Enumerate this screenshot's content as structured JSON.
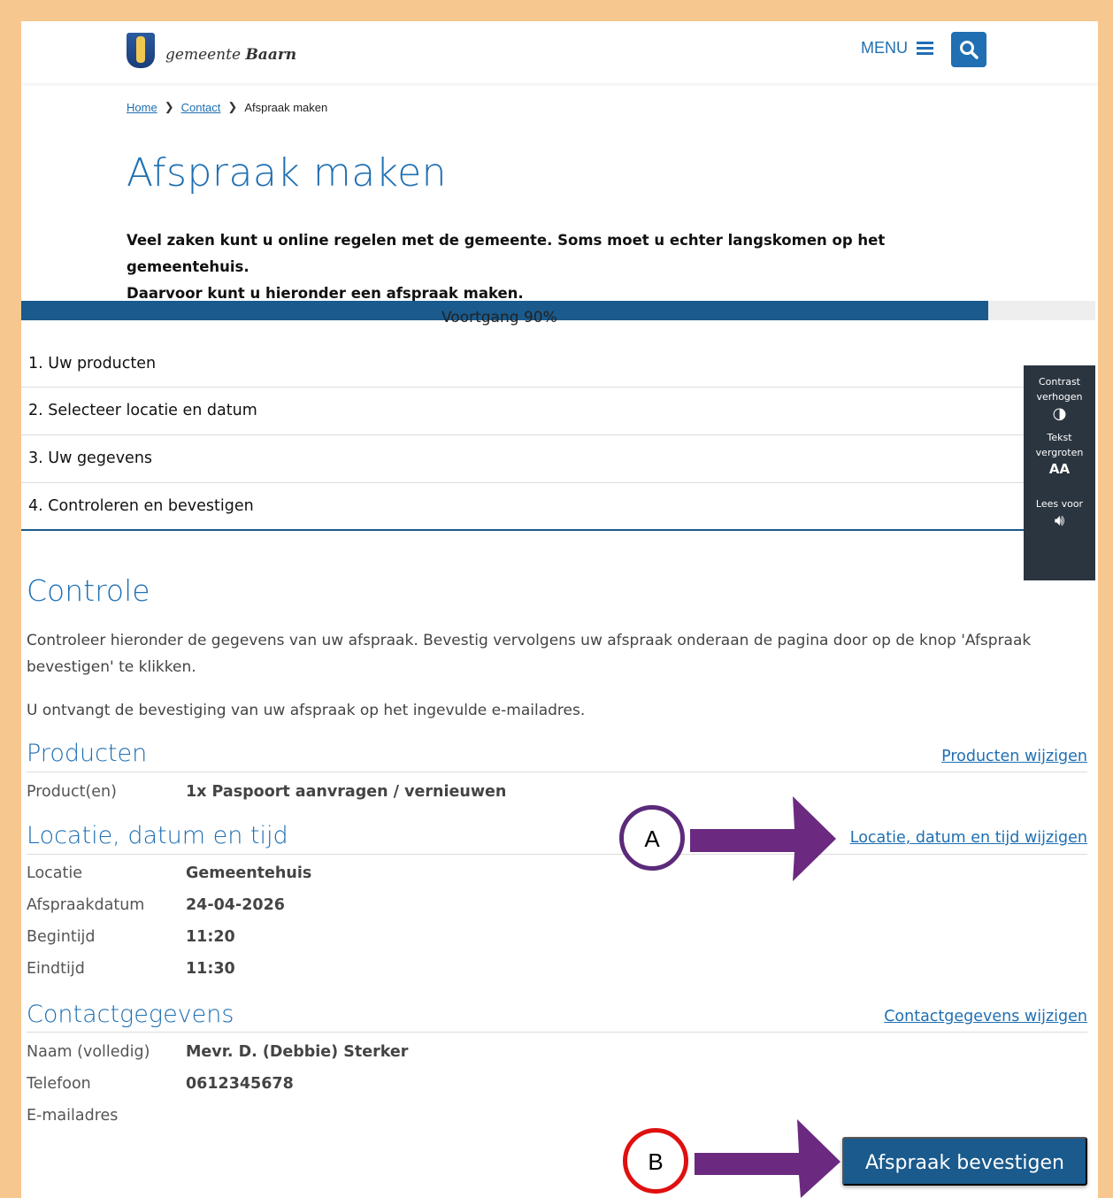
{
  "header": {
    "logo_prefix": "gemeente",
    "logo_name": "Baarn",
    "menu_label": "MENU"
  },
  "breadcrumb": {
    "home": "Home",
    "contact": "Contact",
    "current": "Afspraak maken"
  },
  "page_title": "Afspraak maken",
  "intro": {
    "line1": "Veel zaken kunt u online regelen met de gemeente. Soms moet u echter langskomen op het gemeentehuis.",
    "line2": "Daarvoor kunt u hieronder een afspraak maken."
  },
  "progress": {
    "label": "Voortgang 90%",
    "value_percent": 90
  },
  "steps": [
    "1. Uw producten",
    "2. Selecteer locatie en datum",
    "3. Uw gegevens",
    "4. Controleren en bevestigen"
  ],
  "accessibility": {
    "contrast_line1": "Contrast",
    "contrast_line2": "verhogen",
    "text_line1": "Tekst",
    "text_line2": "vergroten",
    "text_icon": "AA",
    "read_label": "Lees voor"
  },
  "controle": {
    "heading": "Controle",
    "para1": "Controleer hieronder de gegevens van uw afspraak. Bevestig vervolgens uw afspraak onderaan de pagina door op de knop 'Afspraak bevestigen' te klikken.",
    "para2": "U ontvangt de bevestiging van uw afspraak op het ingevulde e-mailadres."
  },
  "producten": {
    "heading": "Producten",
    "edit_link": "Producten wijzigen",
    "rows": [
      {
        "label": "Product(en)",
        "value": "1x Paspoort aanvragen / vernieuwen"
      }
    ]
  },
  "locatie": {
    "heading": "Locatie, datum en tijd",
    "edit_link": "Locatie, datum en tijd wijzigen",
    "rows": [
      {
        "label": "Locatie",
        "value": "Gemeentehuis"
      },
      {
        "label": "Afspraakdatum",
        "value": "24-04-2026"
      },
      {
        "label": "Begintijd",
        "value": "11:20"
      },
      {
        "label": "Eindtijd",
        "value": "11:30"
      }
    ]
  },
  "contact": {
    "heading": "Contactgegevens",
    "edit_link": "Contactgegevens wijzigen",
    "rows": [
      {
        "label": "Naam (volledig)",
        "value": "Mevr. D. (Debbie) Sterker"
      },
      {
        "label": "Telefoon",
        "value": "0612345678"
      },
      {
        "label": "E-mailadres",
        "value": ""
      }
    ]
  },
  "confirm_button": "Afspraak bevestigen",
  "annotations": {
    "a": "A",
    "b": "B",
    "arrow_color": "#6b2a7f",
    "circle_a_color": "#5b2a7a",
    "circle_b_color": "#e01010"
  },
  "colors": {
    "brand_blue": "#1f6fb2",
    "dark_blue": "#1a5a8c",
    "frame": "#f6c78f"
  }
}
